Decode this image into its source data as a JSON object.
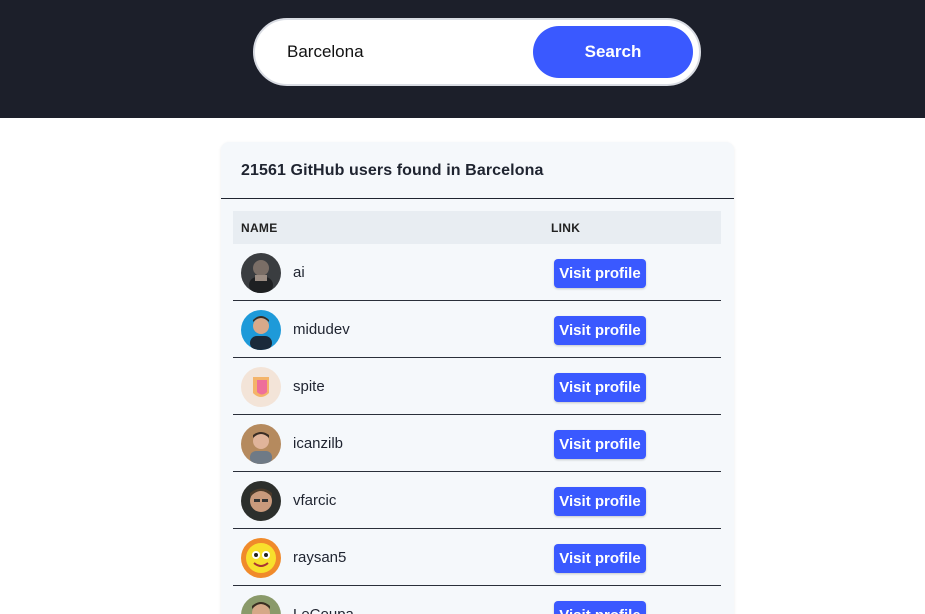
{
  "search": {
    "value": "Barcelona",
    "button_label": "Search"
  },
  "results": {
    "title": "21561 GitHub users found in Barcelona",
    "columns": [
      "NAME",
      "LINK"
    ],
    "rows": [
      {
        "name": "ai",
        "link_label": "Visit profile"
      },
      {
        "name": "midudev",
        "link_label": "Visit profile"
      },
      {
        "name": "spite",
        "link_label": "Visit profile"
      },
      {
        "name": "icanzilb",
        "link_label": "Visit profile"
      },
      {
        "name": "vfarcic",
        "link_label": "Visit profile"
      },
      {
        "name": "raysan5",
        "link_label": "Visit profile"
      },
      {
        "name": "LeCoupa",
        "link_label": "Visit profile"
      }
    ]
  },
  "colors": {
    "header_bg": "#1c1f2a",
    "accent": "#3a59ff",
    "card_bg": "#f5f8fb",
    "table_head_bg": "#e8edf2"
  }
}
